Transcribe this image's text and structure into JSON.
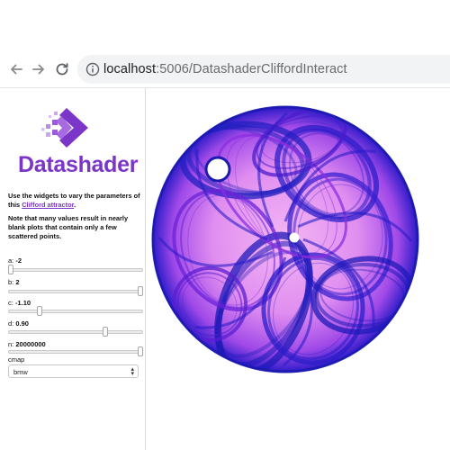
{
  "browser": {
    "url_host": "localhost",
    "url_rest": ":5006/DatashaderCliffordInteract"
  },
  "sidebar": {
    "logo_text": "Datashader",
    "intro_prefix": "Use the widgets to vary the parameters of this ",
    "intro_link": "Clifford attractor",
    "intro_suffix": ".",
    "note": "Note that many values result in nearly blank plots that contain only a few scattered points."
  },
  "controls": {
    "a": {
      "label": "a:",
      "value": "-2",
      "fraction": 0.0
    },
    "b": {
      "label": "b:",
      "value": "2",
      "fraction": 1.0
    },
    "c": {
      "label": "c:",
      "value": "-1.10",
      "fraction": 0.22
    },
    "d": {
      "label": "d:",
      "value": "0.90",
      "fraction": 0.73
    },
    "n": {
      "label": "n:",
      "value": "20000000",
      "fraction": 1.0
    },
    "cmap": {
      "label": "cmap",
      "value": "bmw"
    }
  },
  "colors": {
    "accent": "#7b35c8",
    "plot_dark": "#1a1ab8",
    "plot_mid": "#7a20e0",
    "plot_light": "#f5b8f5"
  },
  "icons": [
    "back-arrow-icon",
    "forward-arrow-icon",
    "reload-icon",
    "info-icon",
    "chevron-updown-icon"
  ]
}
